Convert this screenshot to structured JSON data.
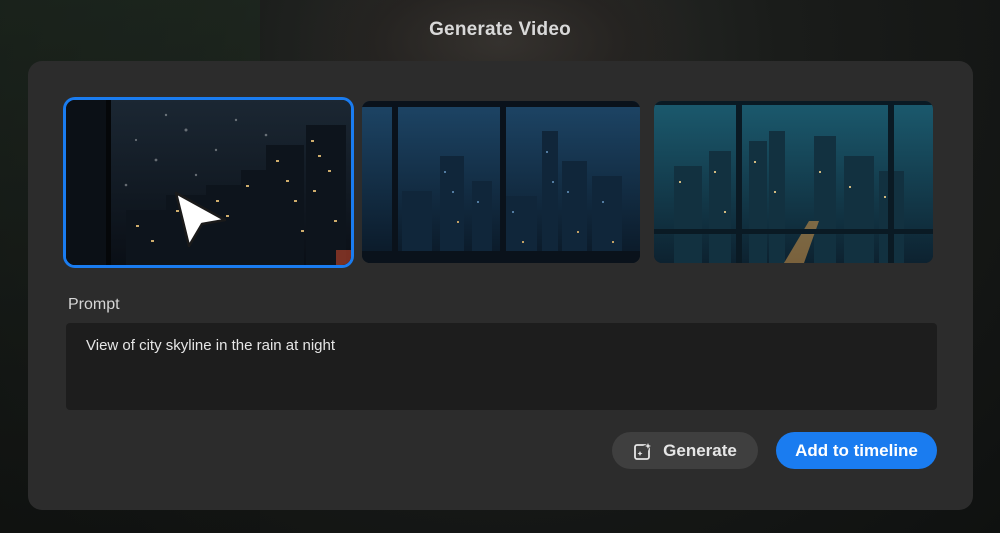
{
  "dialog": {
    "title": "Generate Video"
  },
  "thumbnails": [
    {
      "icon": "generated-video-thumbnail",
      "selected": true
    },
    {
      "icon": "generated-video-thumbnail",
      "selected": false
    },
    {
      "icon": "generated-video-thumbnail",
      "selected": false
    }
  ],
  "prompt": {
    "label": "Prompt",
    "value": "View of city skyline in the rain at night"
  },
  "actions": {
    "generate_label": "Generate",
    "generate_icon": "sparkle-generate-icon",
    "add_label": "Add to timeline"
  },
  "colors": {
    "accent": "#1a7cf0",
    "dialog_bg": "#2c2c2c",
    "input_bg": "#1d1d1d"
  }
}
